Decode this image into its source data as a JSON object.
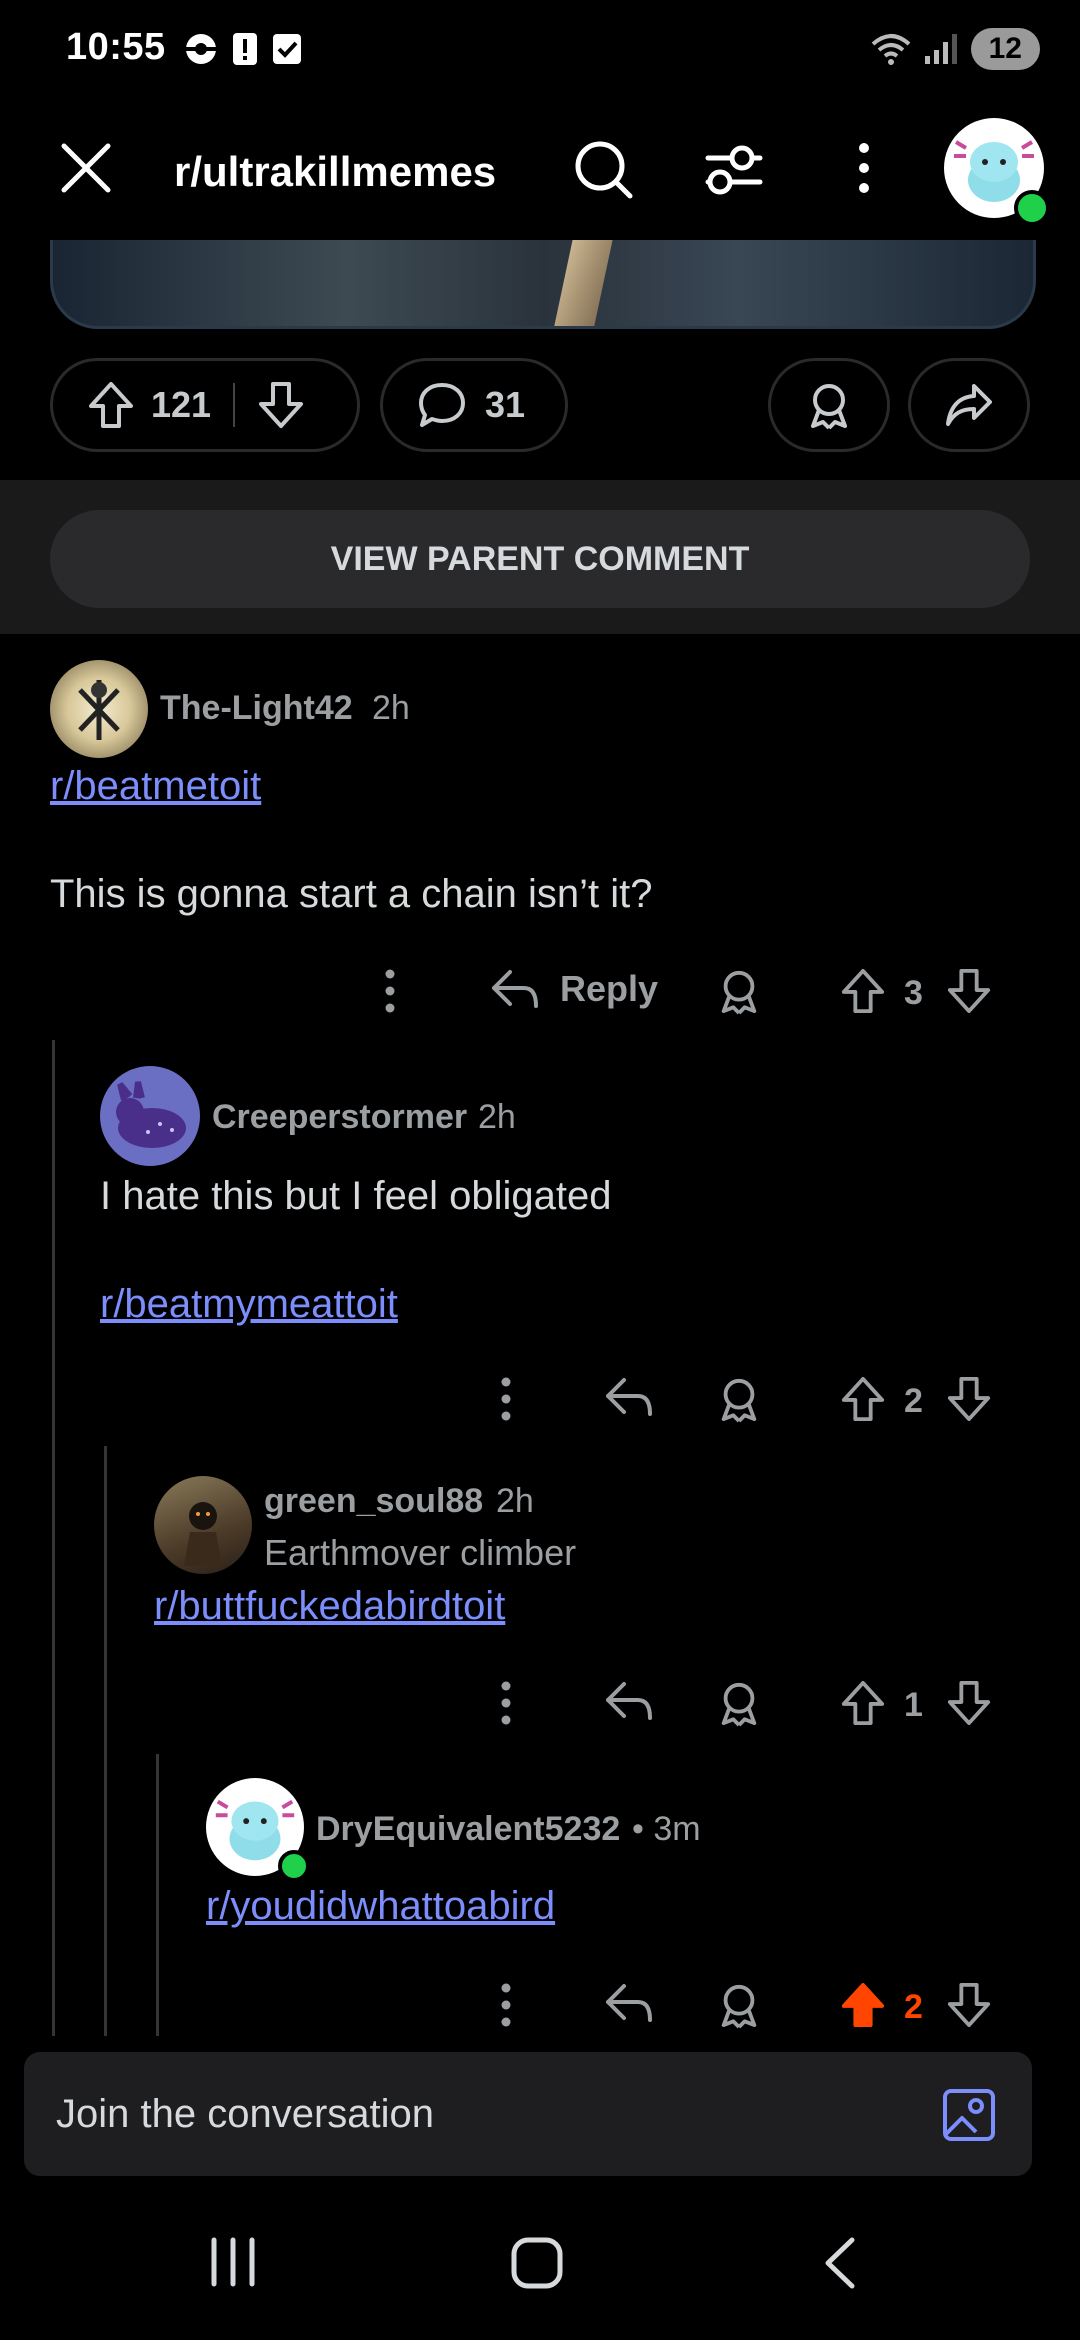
{
  "status_bar": {
    "time": "10:55",
    "battery": "12"
  },
  "header": {
    "title": "r/ultrakillmemes"
  },
  "post_actions": {
    "upvotes": "121",
    "comments": "31"
  },
  "view_parent_label": "VIEW PARENT COMMENT",
  "comments": [
    {
      "user": "The-Light42",
      "time": "2h",
      "link": "r/beatmetoit",
      "body": "This is gonna start a chain isn’t it?",
      "reply_label": "Reply",
      "votes": "3"
    },
    {
      "user": "Creeperstormer",
      "time": "2h",
      "body": "I hate this but I feel obligated",
      "link": "r/beatmymeattoit",
      "votes": "2"
    },
    {
      "user": "green_soul88",
      "time": "2h",
      "flair": "Earthmover climber",
      "link": "r/buttfuckedabirdtoit",
      "votes": "1"
    },
    {
      "user": "DryEquivalent5232",
      "time": "• 3m",
      "link": "r/youdidwhattoabird",
      "votes": "2"
    }
  ],
  "composer": {
    "placeholder": "Join the conversation"
  },
  "colors": {
    "upvoted": "#ff4500",
    "link": "#7c8dfc",
    "online": "#1fd14a"
  }
}
